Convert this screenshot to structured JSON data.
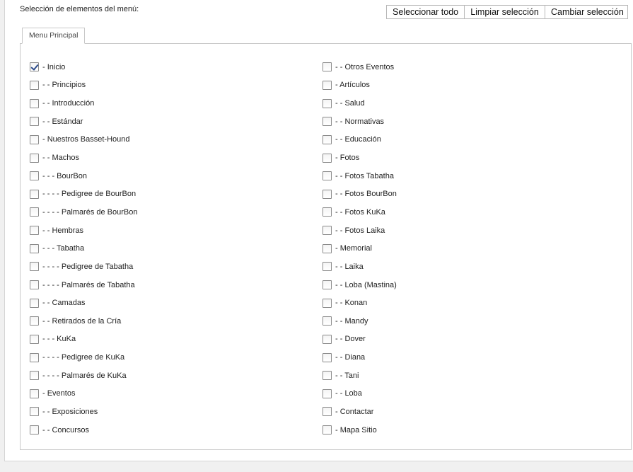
{
  "header": {
    "section_label": "Selección de elementos del menú:",
    "buttons": {
      "select_all": "Seleccionar todo",
      "clear": "Limpiar selección",
      "toggle": "Cambiar selección"
    }
  },
  "tab": {
    "label": "Menu Principal"
  },
  "items_left": [
    {
      "label": "- Inicio",
      "checked": true
    },
    {
      "label": "- - Principios",
      "checked": false
    },
    {
      "label": "- - Introducción",
      "checked": false
    },
    {
      "label": "- - Estándar",
      "checked": false
    },
    {
      "label": "- Nuestros Basset-Hound",
      "checked": false
    },
    {
      "label": "- - Machos",
      "checked": false
    },
    {
      "label": "- - - BourBon",
      "checked": false
    },
    {
      "label": "- - - - Pedigree de BourBon",
      "checked": false
    },
    {
      "label": "- - - - Palmarés de BourBon",
      "checked": false
    },
    {
      "label": "- - Hembras",
      "checked": false
    },
    {
      "label": "- - - Tabatha",
      "checked": false
    },
    {
      "label": "- - - - Pedigree de Tabatha",
      "checked": false
    },
    {
      "label": "- - - - Palmarés de Tabatha",
      "checked": false
    },
    {
      "label": "- - Camadas",
      "checked": false
    },
    {
      "label": "- - Retirados de la Cría",
      "checked": false
    },
    {
      "label": "- - - KuKa",
      "checked": false
    },
    {
      "label": "- - - - Pedigree de KuKa",
      "checked": false
    },
    {
      "label": "- - - - Palmarés de KuKa",
      "checked": false
    },
    {
      "label": "- Eventos",
      "checked": false
    },
    {
      "label": "- - Exposiciones",
      "checked": false
    },
    {
      "label": "- - Concursos",
      "checked": false
    }
  ],
  "items_right": [
    {
      "label": "- - Otros Eventos",
      "checked": false
    },
    {
      "label": "- Artículos",
      "checked": false
    },
    {
      "label": "- - Salud",
      "checked": false
    },
    {
      "label": "- - Normativas",
      "checked": false
    },
    {
      "label": "- - Educación",
      "checked": false
    },
    {
      "label": "- Fotos",
      "checked": false
    },
    {
      "label": "- - Fotos Tabatha",
      "checked": false
    },
    {
      "label": "- - Fotos BourBon",
      "checked": false
    },
    {
      "label": "- - Fotos KuKa",
      "checked": false
    },
    {
      "label": "- - Fotos Laika",
      "checked": false
    },
    {
      "label": "- Memorial",
      "checked": false
    },
    {
      "label": "- - Laika",
      "checked": false
    },
    {
      "label": "- - Loba (Mastina)",
      "checked": false
    },
    {
      "label": "- - Konan",
      "checked": false
    },
    {
      "label": "- - Mandy",
      "checked": false
    },
    {
      "label": "- - Dover",
      "checked": false
    },
    {
      "label": "- - Diana",
      "checked": false
    },
    {
      "label": "- - Tani",
      "checked": false
    },
    {
      "label": "- - Loba",
      "checked": false
    },
    {
      "label": "- Contactar",
      "checked": false
    },
    {
      "label": "- Mapa Sitio",
      "checked": false
    }
  ]
}
